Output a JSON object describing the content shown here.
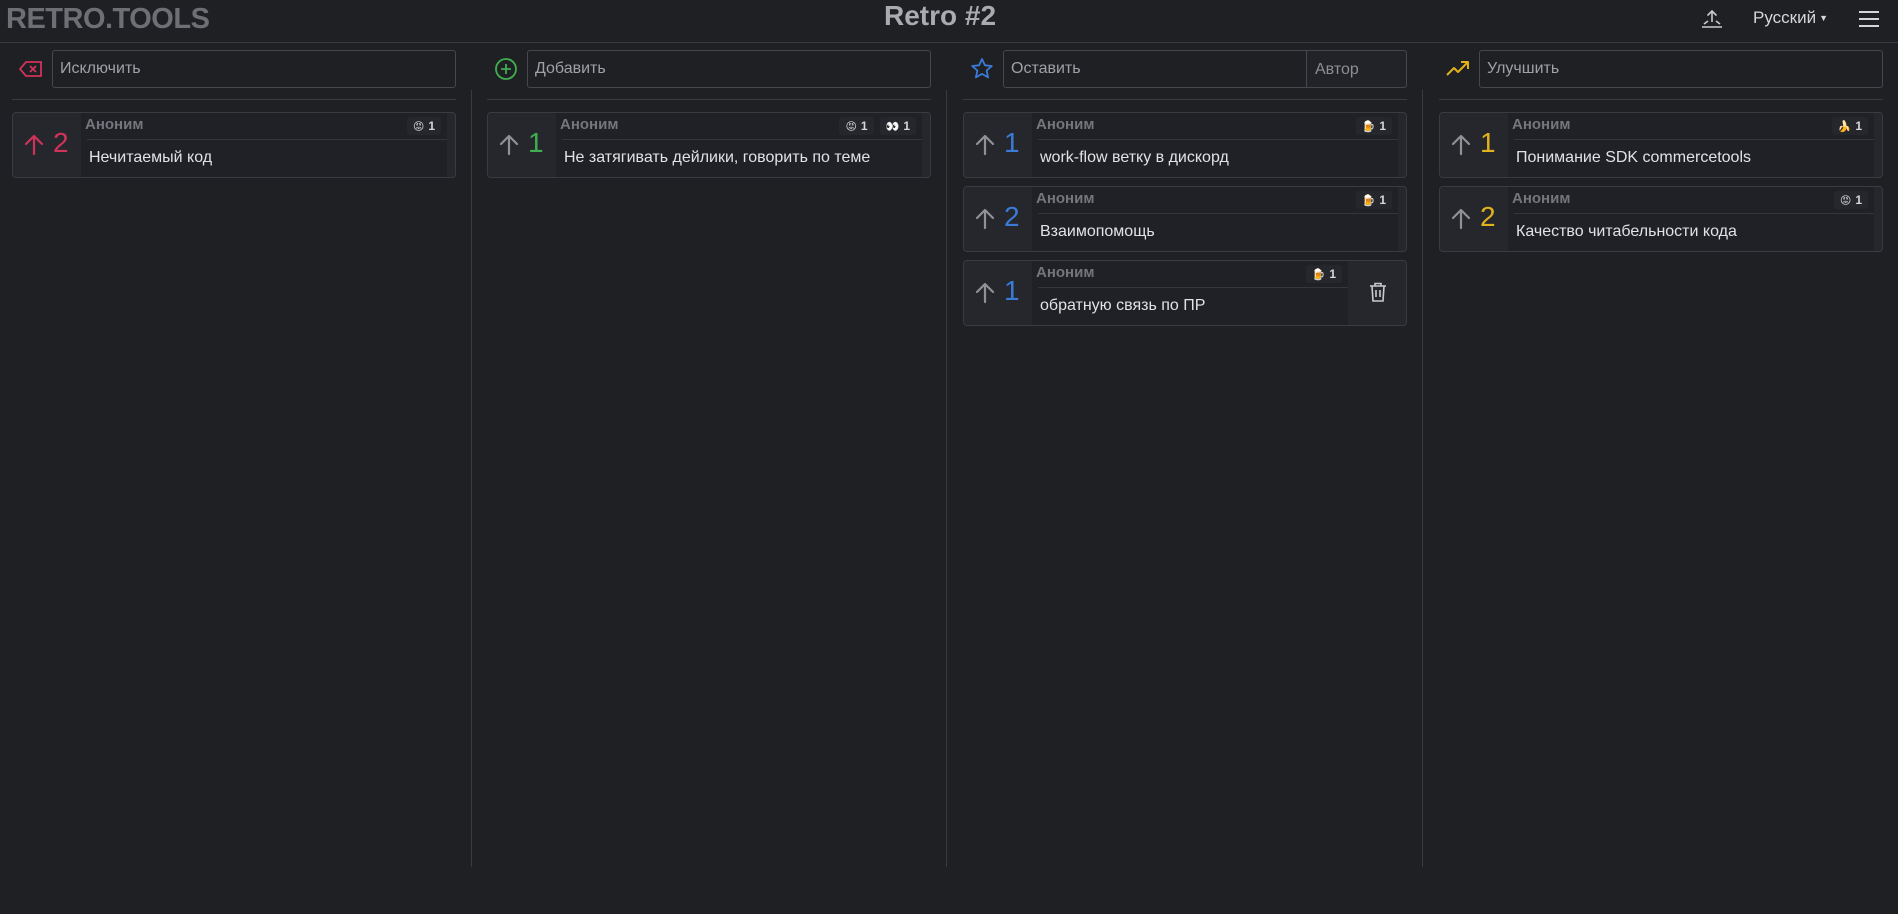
{
  "app": {
    "logo": "RETRO.TOOLS",
    "title": "Retro #2",
    "language": "Русский"
  },
  "colors": {
    "exclude": "#d0325a",
    "add": "#3fae4f",
    "keep": "#3a7bd8",
    "improve": "#e0b21c",
    "neutral_arrow": "#8f9196"
  },
  "columns": [
    {
      "name": "exclude",
      "icon": "backspace-x-icon",
      "placeholder": "Исключить",
      "cards": [
        {
          "author": "Аноним",
          "votes": "2",
          "text": "Нечитаемый код",
          "reactions": [
            {
              "emoji": "😡",
              "count": "1"
            }
          ],
          "voted": true
        }
      ]
    },
    {
      "name": "add",
      "icon": "plus-circle-icon",
      "placeholder": "Добавить",
      "cards": [
        {
          "author": "Аноним",
          "votes": "1",
          "text": "Не затягивать дейлики, говорить по теме",
          "reactions": [
            {
              "emoji": "😡",
              "count": "1"
            },
            {
              "emoji": "👀",
              "count": "1"
            }
          ],
          "voted": false
        }
      ]
    },
    {
      "name": "keep",
      "icon": "star-icon",
      "placeholder": "Оставить",
      "author_button": "Автор",
      "cards": [
        {
          "author": "Аноним",
          "votes": "1",
          "text": "work-flow ветку в дискорд",
          "reactions": [
            {
              "emoji": "🍺",
              "count": "1"
            }
          ],
          "voted": false
        },
        {
          "author": "Аноним",
          "votes": "2",
          "text": "Взаимопомощь",
          "reactions": [
            {
              "emoji": "🍺",
              "count": "1"
            }
          ],
          "voted": false
        },
        {
          "author": "Аноним",
          "votes": "1",
          "text": "обратную связь по ПР",
          "reactions": [
            {
              "emoji": "🍺",
              "count": "1"
            }
          ],
          "voted": false,
          "deletable": true
        }
      ]
    },
    {
      "name": "improve",
      "icon": "trending-up-icon",
      "placeholder": "Улучшить",
      "cards": [
        {
          "author": "Аноним",
          "votes": "1",
          "text": "Понимание SDK commercetools",
          "reactions": [
            {
              "emoji": "🍌",
              "count": "1"
            }
          ],
          "voted": false
        },
        {
          "author": "Аноним",
          "votes": "2",
          "text": "Качество читабельности кода",
          "reactions": [
            {
              "emoji": "😡",
              "count": "1"
            }
          ],
          "voted": false
        }
      ]
    }
  ]
}
